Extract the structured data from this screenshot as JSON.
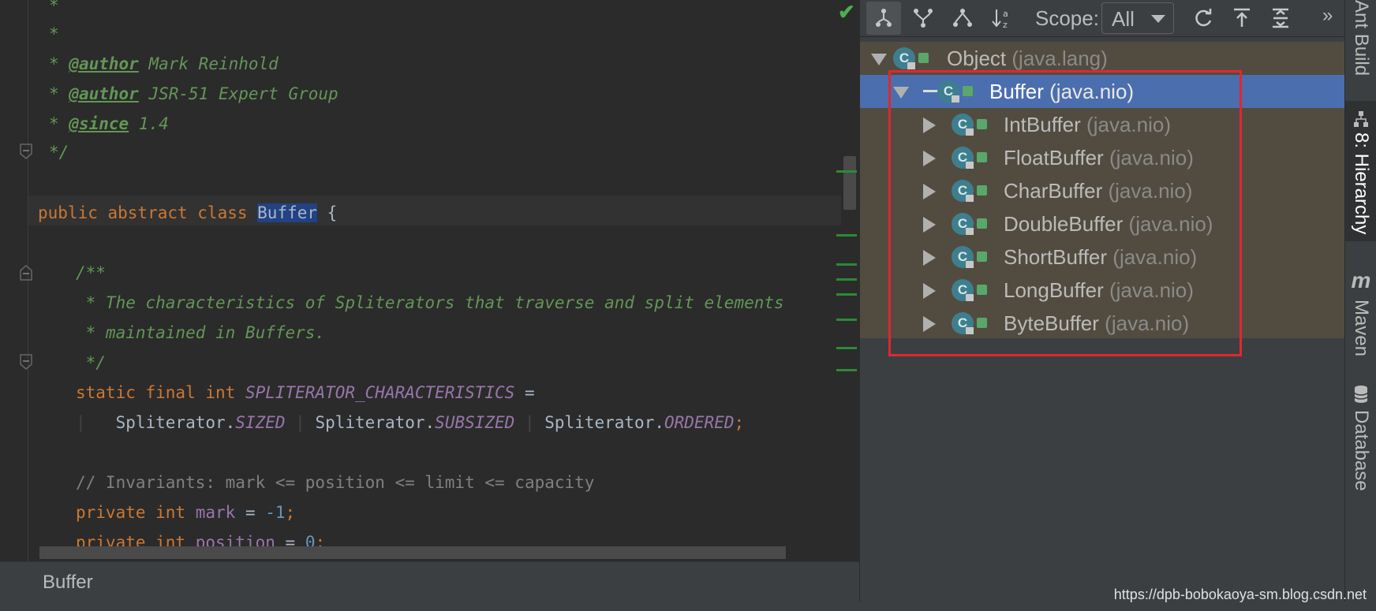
{
  "editor": {
    "lines": {
      "l1": "*",
      "l2": "*",
      "l3_star": "* ",
      "l3_tag": "@author",
      "l3_text": " Mark Reinhold",
      "l4_star": "* ",
      "l4_tag": "@author",
      "l4_text": " JSR-51 Expert Group",
      "l5_star": "* ",
      "l5_tag": "@since",
      "l5_text": " 1.4",
      "l6": "*/",
      "l7_kw": "public abstract class ",
      "l7_name": "Buffer",
      "l7_rest": " {",
      "l8": "/**",
      "l9": " * The characteristics of Spliterators that traverse and split elements",
      "l10": " * maintained in Buffers.",
      "l11": " */",
      "l12_kw": "static final int ",
      "l12_field": "SPLITERATOR_CHARACTERISTICS",
      "l12_rest": " =",
      "l13_a": "Spliterator.",
      "l13_b": "SIZED",
      "l13_sep1": " | ",
      "l13_c": "Spliterator.",
      "l13_d": "SUBSIZED",
      "l13_sep2": " | ",
      "l13_e": "Spliterator.",
      "l13_f": "ORDERED",
      "l13_end": ";",
      "l14": "// Invariants: mark <= position <= limit <= capacity",
      "l15_kw": "private int ",
      "l15_field": "mark",
      "l15_eq": " = ",
      "l15_num": "-1",
      "l15_end": ";",
      "l16_kw": "private int ",
      "l16_field": "position",
      "l16_eq": " = ",
      "l16_num": "0",
      "l16_end": ";"
    }
  },
  "bottom_bar": {
    "text": "Buffer"
  },
  "hierarchy": {
    "toolbar": {
      "scope_label": "Scope:",
      "scope_value": "All",
      "more": "»"
    },
    "root": {
      "name": "Object",
      "package": "(java.lang)"
    },
    "selected": {
      "name": "Buffer",
      "package": "(java.nio)"
    },
    "children": [
      {
        "name": "IntBuffer",
        "package": "(java.nio)"
      },
      {
        "name": "FloatBuffer",
        "package": "(java.nio)"
      },
      {
        "name": "CharBuffer",
        "package": "(java.nio)"
      },
      {
        "name": "DoubleBuffer",
        "package": "(java.nio)"
      },
      {
        "name": "ShortBuffer",
        "package": "(java.nio)"
      },
      {
        "name": "LongBuffer",
        "package": "(java.nio)"
      },
      {
        "name": "ByteBuffer",
        "package": "(java.nio)"
      }
    ],
    "class_icon_letter": "C"
  },
  "tool_strip": {
    "ant_build": "Ant Build",
    "hierarchy": "8: Hierarchy",
    "maven_icon": "m",
    "maven": "Maven",
    "database": "Database"
  },
  "watermark": "https://dpb-bobokaoya-sm.blog.csdn.net"
}
